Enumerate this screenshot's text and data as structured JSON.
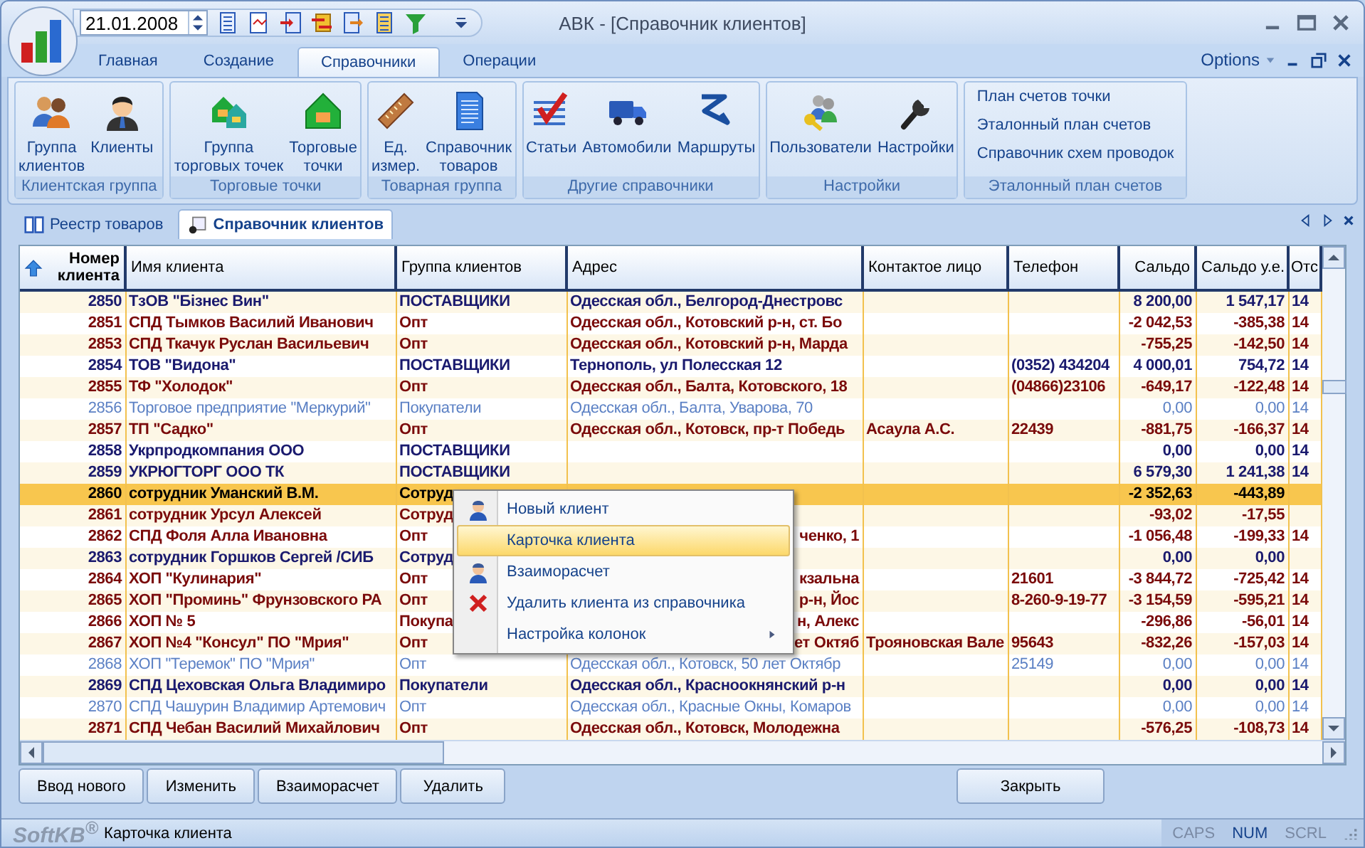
{
  "window": {
    "title": "АВК - [Справочник клиентов]"
  },
  "quick_access": {
    "date": "21.01.2008"
  },
  "ribbon_tabs": [
    {
      "label": "Главная",
      "selected": false
    },
    {
      "label": "Создание",
      "selected": false
    },
    {
      "label": "Справочники",
      "selected": true
    },
    {
      "label": "Операции",
      "selected": false
    }
  ],
  "options": {
    "label": "Options"
  },
  "ribbon_groups": [
    {
      "label": "Клиентская группа",
      "buttons": [
        "Группа\nклиентов",
        "Клиенты"
      ]
    },
    {
      "label": "Торговые точки",
      "buttons": [
        "Группа\nторговых точек",
        "Торговые\nточки"
      ]
    },
    {
      "label": "Товарная группа",
      "buttons": [
        "Ед.\nизмер.",
        "Справочник\nтоваров"
      ]
    },
    {
      "label": "Другие справочники",
      "buttons": [
        "Статьи",
        "Автомобили",
        "Маршруты"
      ]
    },
    {
      "label": "Настройки",
      "buttons": [
        "Пользователи",
        "Настройки"
      ]
    },
    {
      "label": "Эталонный план счетов",
      "links": [
        "План счетов точки",
        "Эталонный план счетов",
        "Справочник схем проводок"
      ]
    }
  ],
  "doc_tabs": [
    {
      "label": "Реестр товаров",
      "selected": false
    },
    {
      "label": "Справочник клиентов",
      "selected": true
    }
  ],
  "table": {
    "columns": [
      "Номер\nклиента",
      "Имя клиента",
      "Группа клиентов",
      "Адрес",
      "Контактое лицо",
      "Телефон",
      "Сальдо",
      "Сальдо у.е.",
      "Отс"
    ],
    "rows": [
      {
        "number": "2850",
        "name": "ТзОВ \"Бізнес Вин\"",
        "group": "ПОСТАВЩИКИ",
        "address": "Одесская обл., Белгород-Днестровс",
        "saldo": "8 200,00",
        "saldo_ue": "1 547,17",
        "column_9": "14",
        "color": "#1a1a6e",
        "active": true,
        "selected": false
      },
      {
        "number": "2851",
        "name": "СПД Тымков Василий Иванович",
        "group": "Опт",
        "address": "Одесская обл., Котовский р-н, ст. Бо",
        "saldo": "-2 042,53",
        "saldo_ue": "-385,38",
        "column_9": "14",
        "color": "#7a0a0a",
        "active": true,
        "selected": false
      },
      {
        "number": "2853",
        "name": "СПД Ткачук Руслан Васильевич",
        "group": "Опт",
        "address": "Одесская обл., Котовский р-н, Марда",
        "saldo": "-755,25",
        "saldo_ue": "-142,50",
        "column_9": "14",
        "color": "#7a0a0a",
        "active": true,
        "selected": false
      },
      {
        "number": "2854",
        "name": "ТОВ \"Видона\"",
        "group": "ПОСТАВЩИКИ",
        "address": "Тернополь, ул Полесская 12",
        "phone": "(0352) 434204",
        "saldo": "4 000,01",
        "saldo_ue": "754,72",
        "column_9": "14",
        "color": "#1a1a6e",
        "active": true,
        "selected": false
      },
      {
        "number": "2855",
        "name": "ТФ \"Холодок\"",
        "group": "Опт",
        "address": "Одесская обл., Балта, Котовского, 18",
        "phone": "(04866)23106",
        "saldo": "-649,17",
        "saldo_ue": "-122,48",
        "column_9": "14",
        "color": "#7a0a0a",
        "active": true,
        "selected": false
      },
      {
        "number": "2856",
        "name": "Торговое предприятие \"Меркурий\"",
        "group": "Покупатели",
        "address": "Одесская обл., Балта, Уварова, 70",
        "saldo": "0,00",
        "saldo_ue": "0,00",
        "column_9": "14",
        "color": "#5b80c4",
        "active": false,
        "selected": false
      },
      {
        "number": "2857",
        "name": "ТП \"Садко\"",
        "group": "Опт",
        "address": "Одесская обл., Котовск, пр-т Победь",
        "contact": "Асаула А.С.",
        "phone": "22439",
        "saldo": "-881,75",
        "saldo_ue": "-166,37",
        "column_9": "14",
        "color": "#7a0a0a",
        "active": true,
        "selected": false
      },
      {
        "number": "2858",
        "name": "Укрпродкомпания ООО",
        "group": "ПОСТАВЩИКИ",
        "saldo": "0,00",
        "saldo_ue": "0,00",
        "column_9": "14",
        "color": "#1a1a6e",
        "active": true,
        "selected": false
      },
      {
        "number": "2859",
        "name": "УКРЮГТОРГ  ООО  ТК",
        "group": "ПОСТАВЩИКИ",
        "saldo": "6 579,30",
        "saldo_ue": "1 241,38",
        "column_9": "14",
        "color": "#1a1a6e",
        "active": true,
        "selected": false
      },
      {
        "number": "2860",
        "name": "сотрудник Уманский В.М.",
        "group": "Сотруд",
        "saldo": "-2 352,63",
        "saldo_ue": "-443,89",
        "color": "#000000",
        "active": true,
        "selected": true
      },
      {
        "number": "2861",
        "name": "сотрудник Урсул Алексей",
        "group": "Сотруд",
        "saldo": "-93,02",
        "saldo_ue": "-17,55",
        "color": "#7a0a0a",
        "active": true,
        "selected": false
      },
      {
        "number": "2862",
        "name": "СПД Фоля Алла Ивановна",
        "group": "Опт",
        "address": "ченко, 1",
        "saldo": "-1 056,48",
        "saldo_ue": "-199,33",
        "column_9": "14",
        "color": "#7a0a0a",
        "active": true,
        "selected": false
      },
      {
        "number": "2863",
        "name": "сотрудник Горшков Сергей /СИБ",
        "group": "Сотруд",
        "saldo": "0,00",
        "saldo_ue": "0,00",
        "color": "#1a1a6e",
        "active": true,
        "selected": false
      },
      {
        "number": "2864",
        "name": "ХОП \"Кулинария\"",
        "group": "Опт",
        "address": "кзальна",
        "phone": "21601",
        "saldo": "-3 844,72",
        "saldo_ue": "-725,42",
        "column_9": "14",
        "color": "#7a0a0a",
        "active": true,
        "selected": false
      },
      {
        "number": "2865",
        "name": "ХОП \"Проминь\" Фрунзовского РА",
        "group": "Опт",
        "address": "р-н, Йос",
        "phone": "8-260-9-19-77",
        "saldo": "-3 154,59",
        "saldo_ue": "-595,21",
        "column_9": "14",
        "color": "#7a0a0a",
        "active": true,
        "selected": false
      },
      {
        "number": "2866",
        "name": "ХОП № 5",
        "group": "Покупа",
        "address": "н, Алекс",
        "saldo": "-296,86",
        "saldo_ue": "-56,01",
        "column_9": "14",
        "color": "#7a0a0a",
        "active": true,
        "selected": false
      },
      {
        "number": "2867",
        "name": "ХОП №4 \"Консул\" ПО \"Мрия\"",
        "group": "Опт",
        "address": "ет Октяб",
        "contact": "Трояновская Вале",
        "phone": "95643",
        "saldo": "-832,26",
        "saldo_ue": "-157,03",
        "column_9": "14",
        "color": "#7a0a0a",
        "active": true,
        "selected": false
      },
      {
        "number": "2868",
        "name": "ХОП \"Теремок\" ПО \"Мрия\"",
        "group": "Опт",
        "address": "Одесская обл., Котовск, 50 лет Октябр",
        "phone": "25149",
        "saldo": "0,00",
        "saldo_ue": "0,00",
        "column_9": "14",
        "color": "#5b80c4",
        "active": false,
        "selected": false
      },
      {
        "number": "2869",
        "name": "СПД Цеховская Ольга Владимиро",
        "group": "Покупатели",
        "address": "Одесская обл., Красноокнянский р-н",
        "saldo": "0,00",
        "saldo_ue": "0,00",
        "column_9": "14",
        "color": "#1a1a6e",
        "active": true,
        "selected": false
      },
      {
        "number": "2870",
        "name": "СПД Чашурин Владимир Артемович",
        "group": "Опт",
        "address": "Одесская обл., Красные Окны, Комаров",
        "saldo": "0,00",
        "saldo_ue": "0,00",
        "column_9": "14",
        "color": "#5b80c4",
        "active": false,
        "selected": false
      },
      {
        "number": "2871",
        "name": "СПД Чебан Василий Михайлович",
        "group": "Опт",
        "address": "Одесская обл., Котовск, Молодежна",
        "saldo": "-576,25",
        "saldo_ue": "-108,73",
        "column_9": "14",
        "color": "#7a0a0a",
        "active": true,
        "selected": false
      }
    ]
  },
  "context_menu": {
    "items": [
      {
        "label": "Новый клиент",
        "selected": false,
        "submenu": false
      },
      {
        "label": "Карточка клиента",
        "selected": true,
        "submenu": false
      },
      {
        "label": "Взаиморасчет",
        "selected": false,
        "submenu": false
      },
      {
        "label": "Удалить клиента из справочника",
        "selected": false,
        "submenu": false
      },
      {
        "label": "Настройка колонок",
        "selected": false,
        "submenu": true
      }
    ]
  },
  "buttons": [
    "Ввод нового",
    "Изменить",
    "Взаиморасчет",
    "Удалить",
    "Закрыть"
  ],
  "status_bar": {
    "logo": "SoftKB$^{®}$",
    "message": "Карточка клиента",
    "indicators": [
      {
        "label": "CAPS",
        "on": false
      },
      {
        "label": "NUM",
        "on": true
      },
      {
        "label": "SCRL",
        "on": false
      }
    ]
  }
}
